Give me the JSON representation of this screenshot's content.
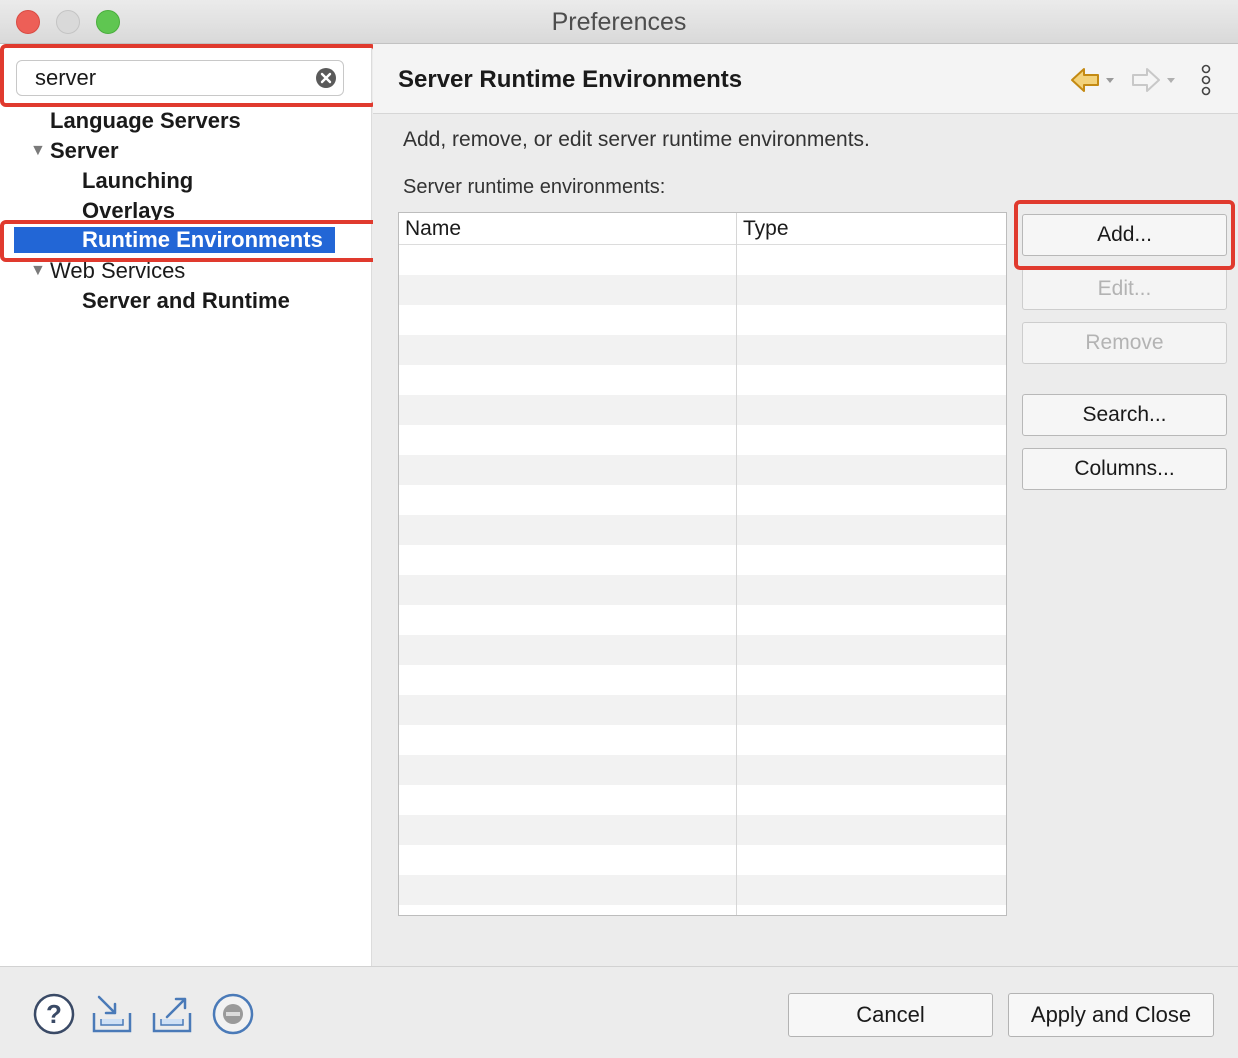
{
  "window": {
    "title": "Preferences"
  },
  "sidebar": {
    "filter": {
      "value": "server"
    },
    "tree": [
      {
        "label": "Language Servers"
      },
      {
        "label": "Server"
      },
      {
        "label": "Launching"
      },
      {
        "label": "Overlays"
      },
      {
        "label": "Runtime Environments",
        "selected": true
      },
      {
        "label": "Web Services"
      },
      {
        "label": "Server and Runtime"
      }
    ]
  },
  "page": {
    "title": "Server Runtime Environments",
    "description": "Add, remove, or edit server runtime environments.",
    "list_label": "Server runtime environments:",
    "table": {
      "columns": [
        "Name",
        "Type"
      ],
      "rows": []
    },
    "buttons": {
      "add": "Add...",
      "edit": "Edit...",
      "remove": "Remove",
      "search": "Search...",
      "columns": "Columns..."
    }
  },
  "footer": {
    "cancel": "Cancel",
    "apply_close": "Apply and Close"
  },
  "icons": {
    "back": "back-arrow-icon",
    "forward": "forward-arrow-icon",
    "menu": "vertical-menu-icon",
    "help": "help-icon",
    "import": "import-icon",
    "export": "export-icon",
    "stop": "stop-icon",
    "clear": "clear-icon"
  },
  "colors": {
    "selection": "#2266d6",
    "highlight": "#e03a2e",
    "nav_back": "#d49a1a"
  }
}
